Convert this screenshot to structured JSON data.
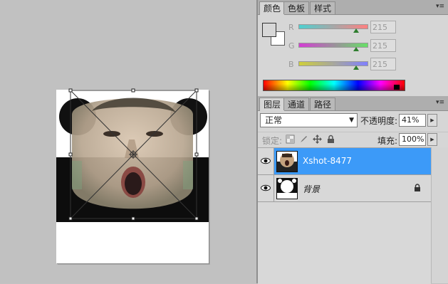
{
  "color_panel": {
    "tabs": [
      {
        "label": "颜色"
      },
      {
        "label": "色板"
      },
      {
        "label": "样式"
      }
    ],
    "menu_icon": "panel-menu-icon",
    "channels": [
      {
        "label": "R",
        "value": "215",
        "level": 0.843,
        "gradient": [
          "#4dd0d0",
          "#ff8080"
        ]
      },
      {
        "label": "G",
        "value": "215",
        "level": 0.843,
        "gradient": [
          "#d43cd4",
          "#66e066"
        ]
      },
      {
        "label": "B",
        "value": "215",
        "level": 0.843,
        "gradient": [
          "#cfcf3a",
          "#8080ff"
        ]
      }
    ],
    "foreground_color": "#d7d7d7",
    "background_color": "#ffffff"
  },
  "layers_panel": {
    "tabs": [
      {
        "label": "图层"
      },
      {
        "label": "通道"
      },
      {
        "label": "路径"
      }
    ],
    "blend_mode": "正常",
    "opacity_label": "不透明度:",
    "opacity_value": "41%",
    "lock_label": "锁定:",
    "fill_label": "填充:",
    "fill_value": "100%",
    "layers": [
      {
        "name": "Xshot-8477",
        "selected": true
      },
      {
        "name": "背景",
        "selected": false,
        "locked": true
      }
    ]
  },
  "colors": {
    "selection": "#3c9af8",
    "panel_bg": "#d6d6d6",
    "canvas_bg": "#c1c1c1"
  }
}
